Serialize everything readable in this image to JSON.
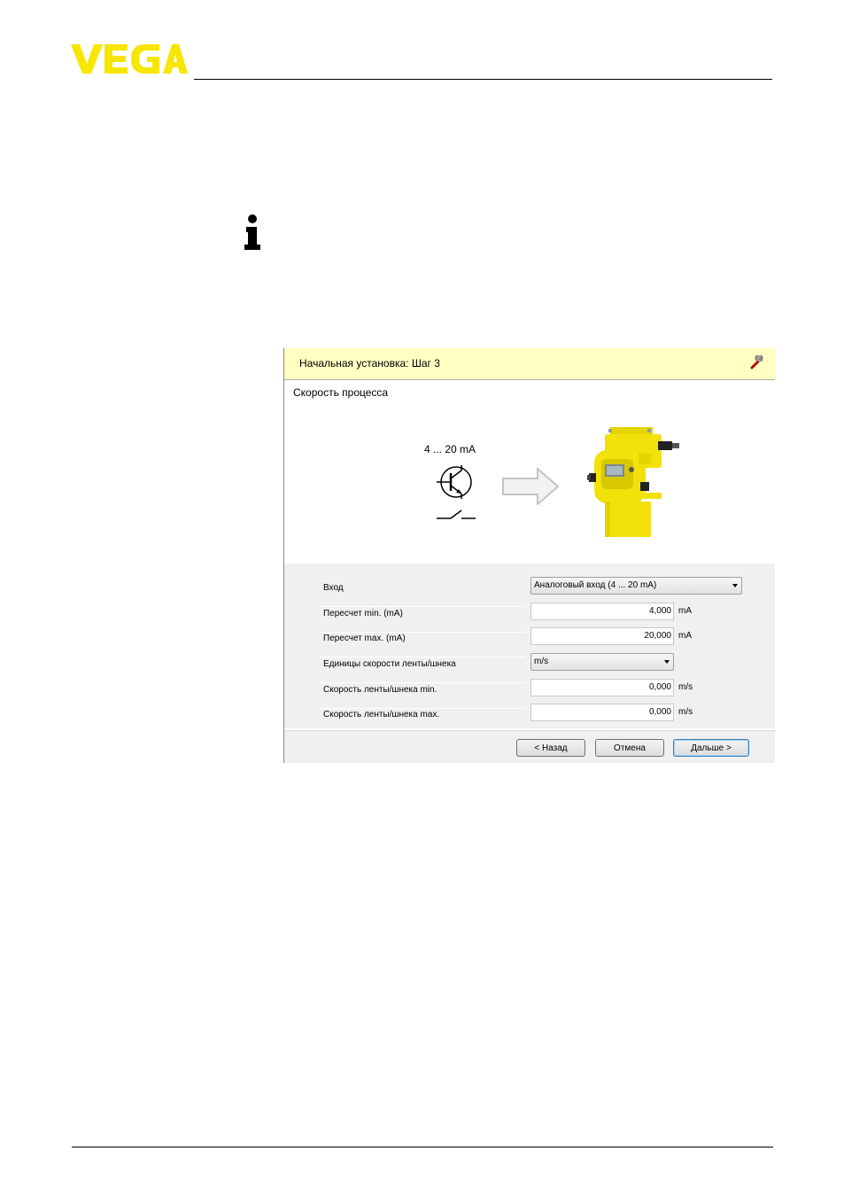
{
  "brand": {
    "name": "VEGA",
    "color": "#f6e600"
  },
  "dialog": {
    "title": "Начальная установка: Шаг 3",
    "section_title": "Скорость процесса",
    "signal_label": "4 ... 20 mA",
    "fields": [
      {
        "label": "Вход",
        "type": "select",
        "value": "Аналоговый вход (4 ... 20 mA)"
      },
      {
        "label": "Пересчет min. (mA)",
        "type": "input",
        "value": "4,000",
        "unit": "mA"
      },
      {
        "label": "Пересчет max. (mA)",
        "type": "input",
        "value": "20,000",
        "unit": "mA"
      },
      {
        "label": "Единицы скорости ленты/шнека",
        "type": "select",
        "value": "m/s"
      },
      {
        "label": "Скорость ленты/шнека min.",
        "type": "input",
        "value": "0,000",
        "unit": "m/s"
      },
      {
        "label": "Скорость ленты/шнека max.",
        "type": "input",
        "value": "0,000",
        "unit": "m/s"
      }
    ],
    "buttons": {
      "back": "< Назад",
      "cancel": "Отмена",
      "next": "Дальше >"
    },
    "colors": {
      "header_bg": "#ffffc2",
      "panel_bg": "#f0f0f0",
      "device_yellow": "#f2e10a"
    }
  }
}
